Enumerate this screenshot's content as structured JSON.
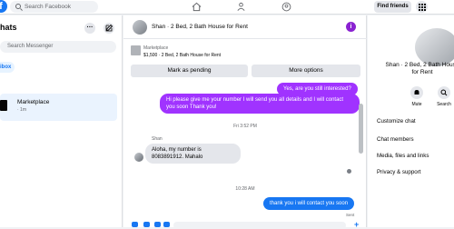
{
  "topbar": {
    "logo_letter": "f",
    "search_placeholder": "Search Facebook",
    "find_friends_label": "Find friends"
  },
  "sidebar": {
    "title": "hats",
    "more_label": "···",
    "search_placeholder": "Search Messenger",
    "filter_label": "ibox",
    "conversations": [
      {
        "title": "Marketplace",
        "meta": "· 1m"
      }
    ]
  },
  "thread": {
    "title": "Shan · 2 Bed, 2 Bath House for Rent",
    "listing_source": "Marketplace",
    "listing_summary": "$1,500 · 2 Bed, 2 Bath House for Rent",
    "mark_pending_label": "Mark as pending",
    "more_options_label": "More options",
    "messages": {
      "m1": "Yes, are you still interested?",
      "m2": "Hi please give me your number I will send you all details and I will contact you soon Thank you!",
      "ts1": "Fri 3:52 PM",
      "sender": "Shan",
      "m3": "Aloha, my number is 8083891912. Mahalo",
      "ts2": "10:28 AM",
      "m4": "thank you i will contact you soon",
      "sent_label": "Sent"
    }
  },
  "details": {
    "name": "Shan · 2 Bed, 2 Bath House for Rent",
    "mute_label": "Mute",
    "search_label": "Search",
    "items": [
      "Customize chat",
      "Chat members",
      "Media, files and links",
      "Privacy & support"
    ]
  },
  "colors": {
    "facebook_blue": "#1877f2",
    "purple_bubble": "#a033ff",
    "info_purple": "#8a22d1"
  }
}
